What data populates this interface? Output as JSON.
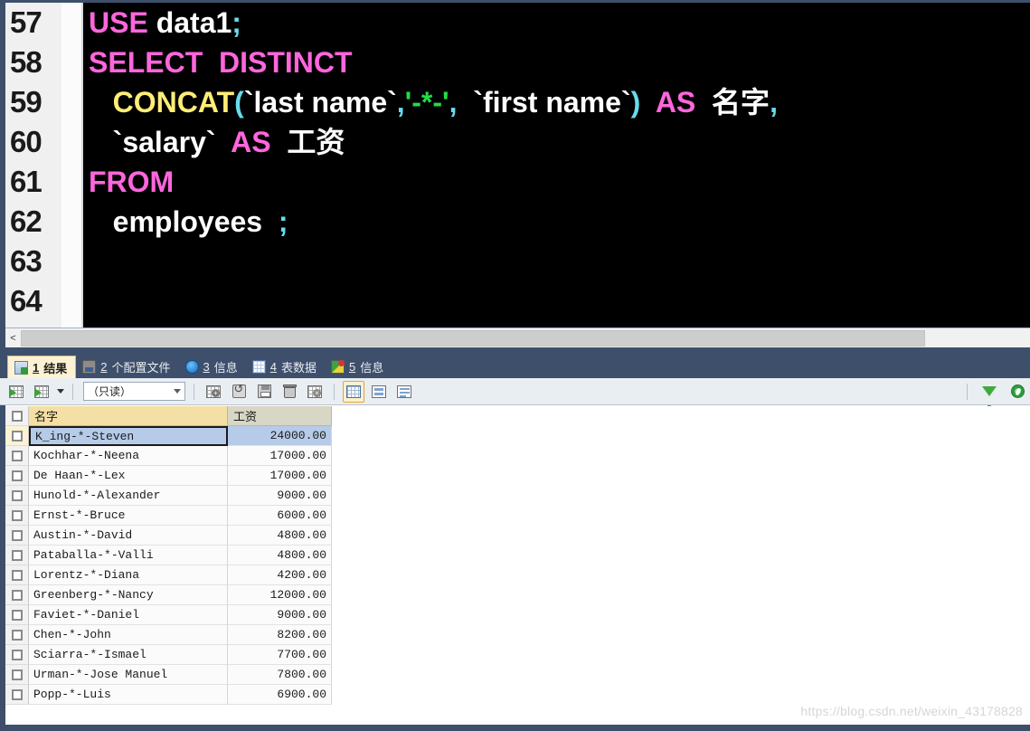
{
  "editor": {
    "lines": [
      {
        "number": "57",
        "tokens": [
          {
            "t": "USE",
            "c": "kw"
          },
          {
            "t": " ",
            "c": "id"
          },
          {
            "t": "data1",
            "c": "id"
          },
          {
            "t": ";",
            "c": "pn"
          }
        ]
      },
      {
        "number": "58",
        "tokens": [
          {
            "t": "SELECT  DISTINCT",
            "c": "kw"
          }
        ]
      },
      {
        "number": "59",
        "tokens": [
          {
            "t": "   ",
            "c": "id"
          },
          {
            "t": "CONCAT",
            "c": "fn"
          },
          {
            "t": "(",
            "c": "pn"
          },
          {
            "t": "`last name`",
            "c": "id"
          },
          {
            "t": ",",
            "c": "pn"
          },
          {
            "t": "'-*-'",
            "c": "str"
          },
          {
            "t": ",  ",
            "c": "pn"
          },
          {
            "t": "`first name`",
            "c": "id"
          },
          {
            "t": ")",
            "c": "pn"
          },
          {
            "t": "  ",
            "c": "id"
          },
          {
            "t": "AS",
            "c": "kw"
          },
          {
            "t": "  ",
            "c": "id"
          },
          {
            "t": "名字",
            "c": "cn"
          },
          {
            "t": ",",
            "c": "pn"
          }
        ]
      },
      {
        "number": "60",
        "tokens": [
          {
            "t": "   ",
            "c": "id"
          },
          {
            "t": "`salary`",
            "c": "id"
          },
          {
            "t": "  ",
            "c": "id"
          },
          {
            "t": "AS",
            "c": "kw"
          },
          {
            "t": "  ",
            "c": "id"
          },
          {
            "t": "工资",
            "c": "cn"
          }
        ]
      },
      {
        "number": "61",
        "tokens": [
          {
            "t": "FROM",
            "c": "kw"
          }
        ]
      },
      {
        "number": "62",
        "tokens": [
          {
            "t": "   ",
            "c": "id"
          },
          {
            "t": "employees",
            "c": "id"
          },
          {
            "t": "  ",
            "c": "id"
          },
          {
            "t": ";",
            "c": "pn"
          }
        ]
      },
      {
        "number": "63",
        "tokens": []
      },
      {
        "number": "64",
        "tokens": []
      }
    ],
    "scroll_left_label": "<"
  },
  "tabs": [
    {
      "num": "1",
      "label": "结果",
      "icon": "results-grid-icon",
      "active": true
    },
    {
      "num": "2",
      "label": "个配置文件",
      "icon": "profile-icon",
      "active": false
    },
    {
      "num": "3",
      "label": "信息",
      "icon": "info-icon",
      "active": false
    },
    {
      "num": "4",
      "label": "表数据",
      "icon": "table-data-icon",
      "active": false
    },
    {
      "num": "5",
      "label": "信息",
      "icon": "message-icon",
      "active": false
    }
  ],
  "toolbar": {
    "import_label": "import-grid-icon",
    "export_label": "export-grid-icon",
    "mode_value": "（只读）",
    "buttons": [
      {
        "name": "add-row-button",
        "icon": "grid-plus-icon"
      },
      {
        "name": "revert-row-button",
        "icon": "revert-icon"
      },
      {
        "name": "save-row-button",
        "icon": "save-disk-icon"
      },
      {
        "name": "delete-row-button",
        "icon": "trash-icon"
      },
      {
        "name": "cancel-edit-button",
        "icon": "grid-cancel-icon"
      }
    ],
    "views": [
      {
        "name": "view-grid-button",
        "icon": "grid-view-icon",
        "selected": true
      },
      {
        "name": "view-form-button",
        "icon": "form-view-icon",
        "selected": false
      },
      {
        "name": "view-text-button",
        "icon": "text-view-icon",
        "selected": false
      }
    ],
    "right_buttons": [
      {
        "name": "filter-button",
        "icon": "funnel-icon"
      },
      {
        "name": "refresh-button",
        "icon": "refresh-icon"
      }
    ]
  },
  "result_grid": {
    "columns": [
      "名字",
      "工资"
    ],
    "rows": [
      {
        "name": "K_ing-*-Steven",
        "salary": "24000.00",
        "selected": true
      },
      {
        "name": "Kochhar-*-Neena",
        "salary": "17000.00",
        "selected": false
      },
      {
        "name": "De Haan-*-Lex",
        "salary": "17000.00",
        "selected": false
      },
      {
        "name": "Hunold-*-Alexander",
        "salary": "9000.00",
        "selected": false
      },
      {
        "name": "Ernst-*-Bruce",
        "salary": "6000.00",
        "selected": false
      },
      {
        "name": "Austin-*-David",
        "salary": "4800.00",
        "selected": false
      },
      {
        "name": "Pataballa-*-Valli",
        "salary": "4800.00",
        "selected": false
      },
      {
        "name": "Lorentz-*-Diana",
        "salary": "4200.00",
        "selected": false
      },
      {
        "name": "Greenberg-*-Nancy",
        "salary": "12000.00",
        "selected": false
      },
      {
        "name": "Faviet-*-Daniel",
        "salary": "9000.00",
        "selected": false
      },
      {
        "name": "Chen-*-John",
        "salary": "8200.00",
        "selected": false
      },
      {
        "name": "Sciarra-*-Ismael",
        "salary": "7700.00",
        "selected": false
      },
      {
        "name": "Urman-*-Jose Manuel",
        "salary": "7800.00",
        "selected": false
      },
      {
        "name": "Popp-*-Luis",
        "salary": "6900.00",
        "selected": false
      }
    ]
  },
  "watermark": "https://blog.csdn.net/weixin_43178828"
}
